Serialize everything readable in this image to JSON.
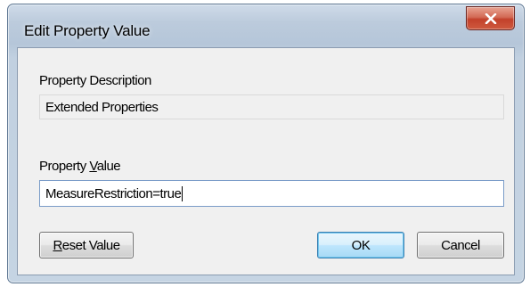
{
  "window": {
    "title": "Edit Property Value",
    "close_icon": "close-icon"
  },
  "description": {
    "label": "Property Description",
    "value": "Extended Properties"
  },
  "property_value": {
    "label_pre": "Property ",
    "label_access_key": "V",
    "label_post": "alue",
    "value": "MeasureRestriction=true"
  },
  "buttons": {
    "reset_access_key": "R",
    "reset_rest": "eset Value",
    "ok": "OK",
    "cancel": "Cancel"
  },
  "colors": {
    "close_button": "#c7432f",
    "frame": "#bccbdc",
    "default_button_border": "#3c7fb1"
  }
}
